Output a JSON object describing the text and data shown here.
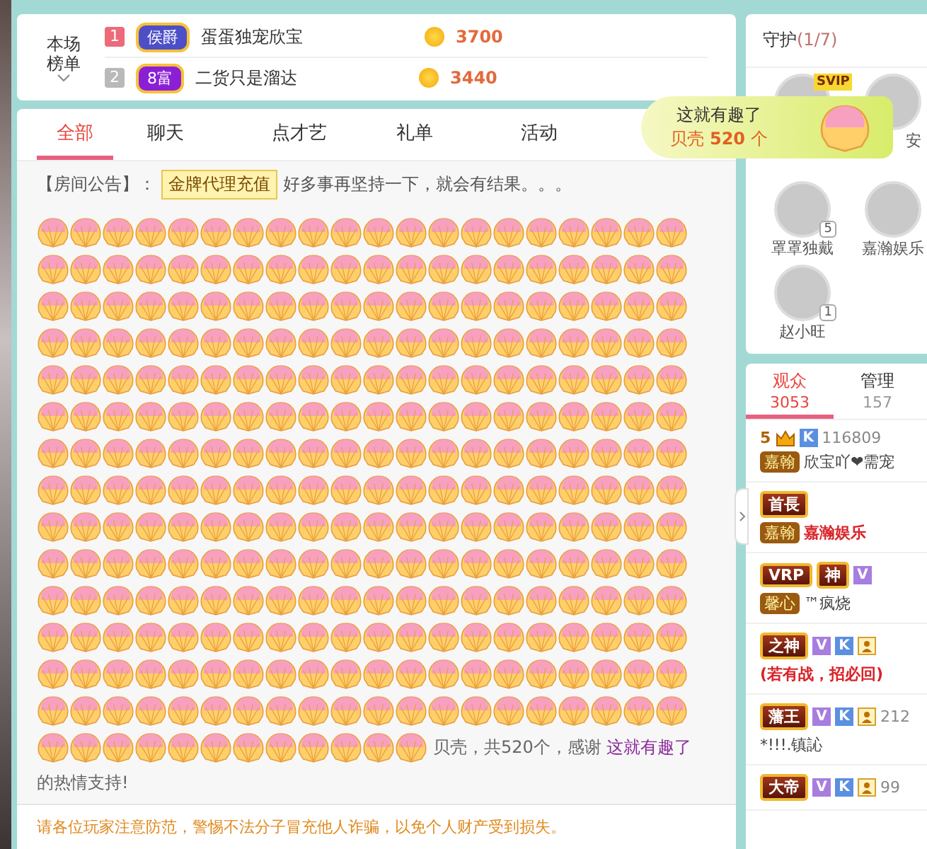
{
  "leaderboard": {
    "label": "本场榜单",
    "rows": [
      {
        "rank": "1",
        "badge": "侯爵",
        "kind": "marquis",
        "name": "蛋蛋独宠欣宝",
        "coins": "3700"
      },
      {
        "rank": "2",
        "badge": "8富",
        "kind": "rich",
        "name": "二货只是溜达",
        "coins": "3440"
      }
    ]
  },
  "tabs": [
    {
      "label": "全部",
      "selected": true
    },
    {
      "label": "聊天",
      "selected": false
    },
    {
      "label": "点才艺",
      "selected": false
    },
    {
      "label": "礼单",
      "selected": false
    },
    {
      "label": "活动",
      "selected": false
    }
  ],
  "announcement": {
    "label": "【房间公告】：",
    "tag": "金牌代理充值",
    "text": "好多事再坚持一下，就会有结果。。。"
  },
  "gift_message": {
    "text": "贝壳，共520个，感谢 ",
    "sender": "这就有趣了",
    "tail": "的热情支持!"
  },
  "warning": "请各位玩家注意防范，警惕不法分子冒充他人诈骗，以免个人财产受到损失。",
  "gift_popup": {
    "sender": "这就有趣了",
    "item": "贝壳",
    "count": "520",
    "unit": "个"
  },
  "guard": {
    "title": "守护",
    "count": "(1/7)",
    "top_badge": "SVIP",
    "top_cut_name": "安",
    "members": [
      {
        "name": "罩罩独戴",
        "level": "5"
      },
      {
        "name": "嘉瀚娱乐"
      },
      {
        "name": "赵小旺",
        "level": "1"
      }
    ]
  },
  "audience_tabs": [
    {
      "label": "观众",
      "count": "3053",
      "selected": true
    },
    {
      "label": "管理",
      "count": "157",
      "selected": false
    }
  ],
  "audience": [
    {
      "titles": [
        "5"
      ],
      "badges": [
        "K"
      ],
      "id": "116809",
      "club": "嘉翰",
      "name": "欣宝吖❤需宠",
      "emphasis": false
    },
    {
      "titles": [
        "首長"
      ],
      "club": "嘉翰",
      "name": "嘉瀚娱乐",
      "emphasis": true
    },
    {
      "titles": [
        "VRP",
        "神"
      ],
      "badges": [
        "V"
      ],
      "club": "馨心",
      "name": "™疯烧",
      "emphasis": false
    },
    {
      "titles": [
        "之神"
      ],
      "badges": [
        "V",
        "K"
      ],
      "name": "(若有战，招必回)",
      "emphasis": true
    },
    {
      "titles": [
        "藩王"
      ],
      "badges": [
        "V",
        "K"
      ],
      "id": "212",
      "name": "*!!!.镇訫",
      "emphasis": false
    },
    {
      "titles": [
        "大帝"
      ],
      "badges": [
        "V",
        "K"
      ],
      "id": "99"
    }
  ]
}
